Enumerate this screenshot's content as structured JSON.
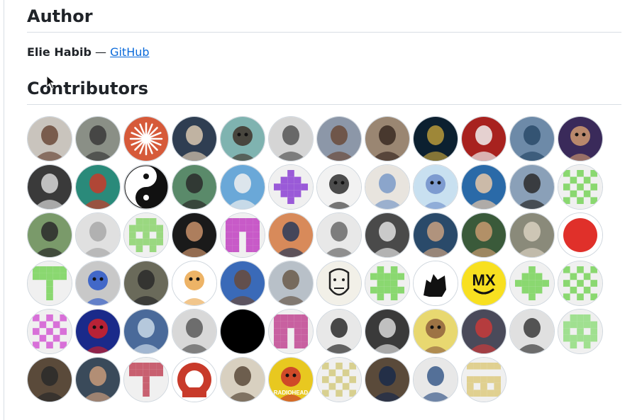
{
  "sections": {
    "author_heading": "Author",
    "author_name": "Elie Habib",
    "author_separator": " — ",
    "author_link": "GitHub",
    "contributors_heading": "Contributors"
  },
  "contributors": [
    {
      "kind": "photo",
      "bg": "#c9c4bd",
      "fg": "#6b4a3a"
    },
    {
      "kind": "photo",
      "bg": "#8a8f86",
      "fg": "#3a3a3a"
    },
    {
      "kind": "burst",
      "bg": "#d65a3a",
      "fg": "#ffffff"
    },
    {
      "kind": "photo",
      "bg": "#2f3e52",
      "fg": "#d9c8b0"
    },
    {
      "kind": "cartoon",
      "bg": "#7fb3b0",
      "fg": "#3b2b22"
    },
    {
      "kind": "photo",
      "bg": "#d5d5d5",
      "fg": "#555555"
    },
    {
      "kind": "photo",
      "bg": "#8c97a8",
      "fg": "#6a4a3a"
    },
    {
      "kind": "photo",
      "bg": "#9a8672",
      "fg": "#3a2a22"
    },
    {
      "kind": "photo",
      "bg": "#0c2030",
      "fg": "#b89a3a"
    },
    {
      "kind": "photo",
      "bg": "#a8221f",
      "fg": "#f0f0f0"
    },
    {
      "kind": "photo",
      "bg": "#6d8aa8",
      "fg": "#2a4a6a"
    },
    {
      "kind": "cartoon",
      "bg": "#3a2a5a",
      "fg": "#d9a070"
    },
    {
      "kind": "photo",
      "bg": "#3a3a3a",
      "fg": "#d8d8d8"
    },
    {
      "kind": "photo",
      "bg": "#2a8a7a",
      "fg": "#c83a2a"
    },
    {
      "kind": "yinyang",
      "bg": "#ffffff",
      "fg": "#111111"
    },
    {
      "kind": "photo",
      "bg": "#5a8a6a",
      "fg": "#2a2a2a"
    },
    {
      "kind": "photo",
      "bg": "#6aa8d8",
      "fg": "#f0f0f0"
    },
    {
      "kind": "identicon",
      "bg": "#f0f0f0",
      "fg": "#9a5ad8",
      "pattern": "plus"
    },
    {
      "kind": "cartoon",
      "bg": "#f2f2f2",
      "fg": "#222222"
    },
    {
      "kind": "photo",
      "bg": "#e8e4de",
      "fg": "#7a9ac8"
    },
    {
      "kind": "cartoon",
      "bg": "#c8e0f0",
      "fg": "#6a8ac8"
    },
    {
      "kind": "photo",
      "bg": "#2a6aa8",
      "fg": "#e8c8a8"
    },
    {
      "kind": "photo",
      "bg": "#8aa0b8",
      "fg": "#2a2a2a"
    },
    {
      "kind": "identicon",
      "bg": "#f0f0f0",
      "fg": "#8ad870",
      "pattern": "checker"
    },
    {
      "kind": "photo",
      "bg": "#7a9a6a",
      "fg": "#2a2a2a"
    },
    {
      "kind": "photo",
      "bg": "#e0e0e0",
      "fg": "#a8a8a8"
    },
    {
      "kind": "identicon",
      "bg": "#f0f0f0",
      "fg": "#9ad880",
      "pattern": "ghost"
    },
    {
      "kind": "photo",
      "bg": "#1a1a1a",
      "fg": "#c8906a"
    },
    {
      "kind": "identicon",
      "bg": "#f0f0f0",
      "fg": "#c85ac8",
      "pattern": "arch"
    },
    {
      "kind": "photo",
      "bg": "#d88a5a",
      "fg": "#2a3a5a"
    },
    {
      "kind": "photo",
      "bg": "#e8e8e8",
      "fg": "#6a6a6a"
    },
    {
      "kind": "photo",
      "bg": "#4a4a4a",
      "fg": "#e0e0e0"
    },
    {
      "kind": "photo",
      "bg": "#2a4a6a",
      "fg": "#c8a080"
    },
    {
      "kind": "photo",
      "bg": "#3a5a3a",
      "fg": "#c89a70"
    },
    {
      "kind": "photo",
      "bg": "#8a8a7a",
      "fg": "#d8d0c0"
    },
    {
      "kind": "redcircle",
      "bg": "#ffffff",
      "fg": "#e0302a"
    },
    {
      "kind": "identicon",
      "bg": "#f0f0f0",
      "fg": "#8ad870",
      "pattern": "tee"
    },
    {
      "kind": "cartoon",
      "bg": "#c8c8c8",
      "fg": "#2050c8"
    },
    {
      "kind": "photo",
      "bg": "#6a6a5a",
      "fg": "#2a2a2a"
    },
    {
      "kind": "cartoon",
      "bg": "#ffffff",
      "fg": "#e8a040"
    },
    {
      "kind": "photo",
      "bg": "#3a6ab8",
      "fg": "#6a4a3a"
    },
    {
      "kind": "photo",
      "bg": "#b8c0c8",
      "fg": "#6a5a4a"
    },
    {
      "kind": "mask",
      "bg": "#f2f0e8",
      "fg": "#222222"
    },
    {
      "kind": "identicon",
      "bg": "#f0f0f0",
      "fg": "#8ad870",
      "pattern": "cross"
    },
    {
      "kind": "silhouette",
      "bg": "#ffffff",
      "fg": "#111111"
    },
    {
      "kind": "mx",
      "bg": "#f8e020",
      "fg": "#111111",
      "text": "MX"
    },
    {
      "kind": "identicon",
      "bg": "#f0f0f0",
      "fg": "#8ad870",
      "pattern": "plus"
    },
    {
      "kind": "identicon",
      "bg": "#f0f0f0",
      "fg": "#8ad870",
      "pattern": "checker"
    },
    {
      "kind": "identicon",
      "bg": "#f0f0f0",
      "fg": "#d870d8",
      "pattern": "checker"
    },
    {
      "kind": "cartoon",
      "bg": "#1a2a8a",
      "fg": "#e02020"
    },
    {
      "kind": "photo",
      "bg": "#4a6a9a",
      "fg": "#c8d8e8"
    },
    {
      "kind": "photo",
      "bg": "#d8d8d8",
      "fg": "#5a5a5a"
    },
    {
      "kind": "solid",
      "bg": "#000000",
      "fg": "#000000"
    },
    {
      "kind": "identicon",
      "bg": "#f0f0f0",
      "fg": "#c860a0",
      "pattern": "arch"
    },
    {
      "kind": "photo",
      "bg": "#e8e8e8",
      "fg": "#2a2a2a"
    },
    {
      "kind": "photo",
      "bg": "#3a3a3a",
      "fg": "#d8d8d8"
    },
    {
      "kind": "cartoon",
      "bg": "#e8d870",
      "fg": "#8a5a3a"
    },
    {
      "kind": "photo",
      "bg": "#4a4a5a",
      "fg": "#c83a3a"
    },
    {
      "kind": "photo",
      "bg": "#e0e0e0",
      "fg": "#3a3a3a"
    },
    {
      "kind": "identicon",
      "bg": "#f0f0f0",
      "fg": "#a0e090",
      "pattern": "ghost"
    },
    {
      "kind": "photo",
      "bg": "#5a4a3a",
      "fg": "#2a2a2a"
    },
    {
      "kind": "photo",
      "bg": "#3a4a5a",
      "fg": "#c89a7a"
    },
    {
      "kind": "identicon",
      "bg": "#f0f0f0",
      "fg": "#c86070",
      "pattern": "tee"
    },
    {
      "kind": "ring",
      "bg": "#ffffff",
      "fg": "#c83a2a"
    },
    {
      "kind": "photo",
      "bg": "#d8d0c0",
      "fg": "#5a4a3a"
    },
    {
      "kind": "cartoon",
      "bg": "#e8c820",
      "fg": "#c82a2a",
      "text": "RADIOHEAD"
    },
    {
      "kind": "identicon",
      "bg": "#f0f0f0",
      "fg": "#d8d090",
      "pattern": "checker"
    },
    {
      "kind": "photo",
      "bg": "#5a4a3a",
      "fg": "#1a2a4a"
    },
    {
      "kind": "photo",
      "bg": "#e8e8e8",
      "fg": "#3a5a8a"
    },
    {
      "kind": "identicon",
      "bg": "#f0f0f0",
      "fg": "#e0d090",
      "pattern": "bars"
    }
  ]
}
